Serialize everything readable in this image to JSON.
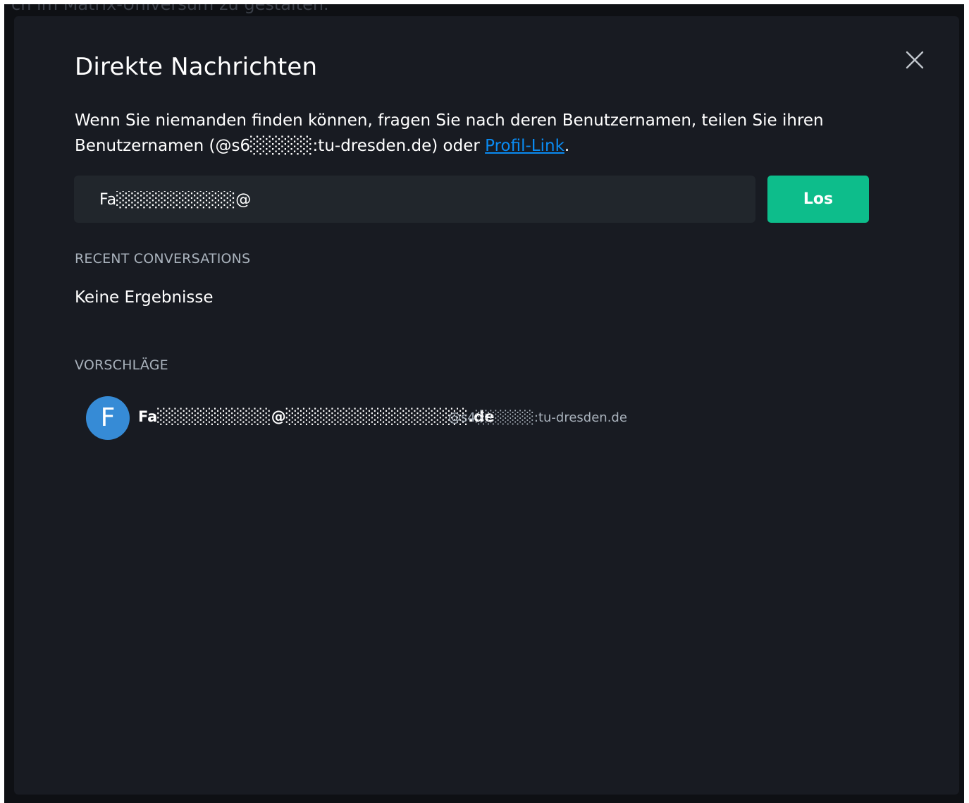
{
  "background": {
    "partial_text": "ch im Matrix-Universum zu gestalten."
  },
  "dialog": {
    "title": "Direkte Nachrichten",
    "description_prefix": "Wenn Sie niemanden finden können, fragen Sie nach deren Benutzernamen, teilen Sie ihren Benutzernamen (@s6",
    "description_masked": "░░░░░",
    "description_middle": ":tu-dresden.de) oder ",
    "profile_link_label": "Profil-Link",
    "description_suffix": ".",
    "close_icon": "close-icon"
  },
  "search": {
    "value": "Fa░░░░░░░░░░@",
    "go_label": "Los"
  },
  "recent": {
    "heading": "RECENT CONVERSATIONS",
    "empty_text": "Keine Ergebnisse"
  },
  "suggestions": {
    "heading": "VORSCHLÄGE",
    "items": [
      {
        "avatar_letter": "F",
        "name": "Fa░░░░░░░░░░@░░░░░░░░░░░░░░░░.de",
        "user_id": "@s4░░░░░░:tu-dresden.de"
      }
    ]
  },
  "colors": {
    "accent_green": "#0dbd8b",
    "link_blue": "#0a8bf2",
    "avatar_blue": "#368bd6",
    "modal_bg": "#181b22"
  }
}
